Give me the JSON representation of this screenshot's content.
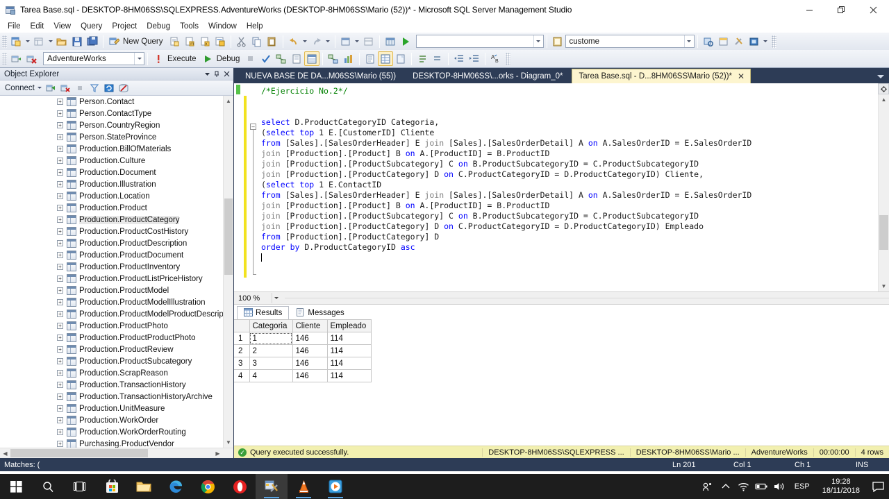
{
  "window": {
    "title": "Tarea Base.sql - DESKTOP-8HM06SS\\SQLEXPRESS.AdventureWorks (DESKTOP-8HM06SS\\Mario (52))* - Microsoft SQL Server Management Studio",
    "minimize": "–",
    "maximize": "❐",
    "close": "✕"
  },
  "menu": {
    "items": [
      "File",
      "Edit",
      "View",
      "Query",
      "Project",
      "Debug",
      "Tools",
      "Window",
      "Help"
    ]
  },
  "toolbar": {
    "new_query_label": "New Query",
    "execute_label": "Execute",
    "debug_label": "Debug",
    "database_combo_value": "AdventureWorks",
    "empty_combo_value": "",
    "find_combo_value": "custome"
  },
  "object_explorer": {
    "title": "Object Explorer",
    "connect_label": "Connect",
    "nodes": [
      "Person.Contact",
      "Person.ContactType",
      "Person.CountryRegion",
      "Person.StateProvince",
      "Production.BillOfMaterials",
      "Production.Culture",
      "Production.Document",
      "Production.Illustration",
      "Production.Location",
      "Production.Product",
      "Production.ProductCategory",
      "Production.ProductCostHistory",
      "Production.ProductDescription",
      "Production.ProductDocument",
      "Production.ProductInventory",
      "Production.ProductListPriceHistory",
      "Production.ProductModel",
      "Production.ProductModelIllustration",
      "Production.ProductModelProductDescrip",
      "Production.ProductPhoto",
      "Production.ProductProductPhoto",
      "Production.ProductReview",
      "Production.ProductSubcategory",
      "Production.ScrapReason",
      "Production.TransactionHistory",
      "Production.TransactionHistoryArchive",
      "Production.UnitMeasure",
      "Production.WorkOrder",
      "Production.WorkOrderRouting",
      "Purchasing.ProductVendor"
    ],
    "selected_node": "Production.ProductCategory",
    "expander_glyph": "+"
  },
  "tabs": [
    {
      "label": "NUEVA BASE DE DA...M06SS\\Mario (55))",
      "active": false
    },
    {
      "label": "DESKTOP-8HM06SS\\...orks - Diagram_0*",
      "active": false
    },
    {
      "label": "Tarea Base.sql - D...8HM06SS\\Mario (52))*",
      "active": true,
      "close": "✕"
    }
  ],
  "editor": {
    "zoom_level": "100 %",
    "fold_glyph": "–",
    "lines": [
      {
        "segments": [
          {
            "t": "/*Ejercicio No.2*/",
            "c": "cm"
          }
        ]
      },
      {
        "segments": []
      },
      {
        "segments": []
      },
      {
        "segments": [
          {
            "t": "select",
            "c": "k"
          },
          {
            "t": " D.ProductCategoryID Categoria,",
            "c": ""
          }
        ]
      },
      {
        "segments": [
          {
            "t": "(",
            "c": ""
          },
          {
            "t": "select",
            "c": "k"
          },
          {
            "t": " ",
            "c": ""
          },
          {
            "t": "top",
            "c": "k"
          },
          {
            "t": " 1 E.[CustomerID] Cliente",
            "c": ""
          }
        ]
      },
      {
        "segments": [
          {
            "t": "from",
            "c": "k"
          },
          {
            "t": " [Sales].[SalesOrderHeader] E ",
            "c": ""
          },
          {
            "t": "join",
            "c": "g"
          },
          {
            "t": " [Sales].[SalesOrderDetail] A ",
            "c": ""
          },
          {
            "t": "on",
            "c": "k"
          },
          {
            "t": " A.SalesOrderID = E.SalesOrderID",
            "c": ""
          }
        ]
      },
      {
        "segments": [
          {
            "t": "join",
            "c": "g"
          },
          {
            "t": " [Production].[Product] B ",
            "c": ""
          },
          {
            "t": "on",
            "c": "k"
          },
          {
            "t": " A.[ProductID] = B.ProductID",
            "c": ""
          }
        ]
      },
      {
        "segments": [
          {
            "t": "join",
            "c": "g"
          },
          {
            "t": " [Production].[ProductSubcategory] C ",
            "c": ""
          },
          {
            "t": "on",
            "c": "k"
          },
          {
            "t": " B.ProductSubcategoryID = C.ProductSubcategoryID",
            "c": ""
          }
        ]
      },
      {
        "segments": [
          {
            "t": "join",
            "c": "g"
          },
          {
            "t": " [Production].[ProductCategory] D ",
            "c": ""
          },
          {
            "t": "on",
            "c": "k"
          },
          {
            "t": " C.ProductCategoryID = D.ProductCategoryID) Cliente,",
            "c": ""
          }
        ]
      },
      {
        "segments": [
          {
            "t": "(",
            "c": ""
          },
          {
            "t": "select",
            "c": "k"
          },
          {
            "t": " ",
            "c": ""
          },
          {
            "t": "top",
            "c": "k"
          },
          {
            "t": " 1 E.ContactID",
            "c": ""
          }
        ]
      },
      {
        "segments": [
          {
            "t": "from",
            "c": "k"
          },
          {
            "t": " [Sales].[SalesOrderHeader] E ",
            "c": ""
          },
          {
            "t": "join",
            "c": "g"
          },
          {
            "t": " [Sales].[SalesOrderDetail] A ",
            "c": ""
          },
          {
            "t": "on",
            "c": "k"
          },
          {
            "t": " A.SalesOrderID = E.SalesOrderID",
            "c": ""
          }
        ]
      },
      {
        "segments": [
          {
            "t": "join",
            "c": "g"
          },
          {
            "t": " [Production].[Product] B ",
            "c": ""
          },
          {
            "t": "on",
            "c": "k"
          },
          {
            "t": " A.[ProductID] = B.ProductID",
            "c": ""
          }
        ]
      },
      {
        "segments": [
          {
            "t": "join",
            "c": "g"
          },
          {
            "t": " [Production].[ProductSubcategory] C ",
            "c": ""
          },
          {
            "t": "on",
            "c": "k"
          },
          {
            "t": " B.ProductSubcategoryID = C.ProductSubcategoryID",
            "c": ""
          }
        ]
      },
      {
        "segments": [
          {
            "t": "join",
            "c": "g"
          },
          {
            "t": " [Production].[ProductCategory] D ",
            "c": ""
          },
          {
            "t": "on",
            "c": "k"
          },
          {
            "t": " C.ProductCategoryID = D.ProductCategoryID) Empleado",
            "c": ""
          }
        ]
      },
      {
        "segments": [
          {
            "t": "from",
            "c": "k"
          },
          {
            "t": " [Production].[ProductCategory] D",
            "c": ""
          }
        ]
      },
      {
        "segments": [
          {
            "t": "order",
            "c": "k"
          },
          {
            "t": " ",
            "c": ""
          },
          {
            "t": "by",
            "c": "k"
          },
          {
            "t": " D.ProductCategoryID ",
            "c": ""
          },
          {
            "t": "asc",
            "c": "k"
          }
        ]
      }
    ]
  },
  "results": {
    "tabs": [
      {
        "label": "Results",
        "active": true
      },
      {
        "label": "Messages",
        "active": false
      }
    ],
    "columns": [
      "Categoria",
      "Cliente",
      "Empleado"
    ],
    "rows": [
      {
        "n": "1",
        "cells": [
          "1",
          "146",
          "114"
        ]
      },
      {
        "n": "2",
        "cells": [
          "2",
          "146",
          "114"
        ]
      },
      {
        "n": "3",
        "cells": [
          "3",
          "146",
          "114"
        ]
      },
      {
        "n": "4",
        "cells": [
          "4",
          "146",
          "114"
        ]
      }
    ],
    "selected_cell": "1",
    "status": {
      "message": "Query executed successfully.",
      "server": "DESKTOP-8HM06SS\\SQLEXPRESS ...",
      "user": "DESKTOP-8HM06SS\\Mario ...",
      "database": "AdventureWorks",
      "elapsed": "00:00:00",
      "rowcount": "4 rows",
      "ok_glyph": "✓"
    }
  },
  "ide_status": {
    "matches": "Matches: (",
    "line": "Ln 201",
    "col": "Col 1",
    "ch": "Ch 1",
    "ins": "INS"
  },
  "taskbar": {
    "language": "ESP",
    "time": "19:28",
    "date": "18/11/2018"
  },
  "colors": {
    "ide_chrome": "#2d3c56",
    "active_tab": "#fdf5cf",
    "status_bar": "#f2f0b0",
    "keyword_blue": "#0000ff",
    "comment_green": "#008000",
    "gutter_yellow": "#f2e21f"
  }
}
